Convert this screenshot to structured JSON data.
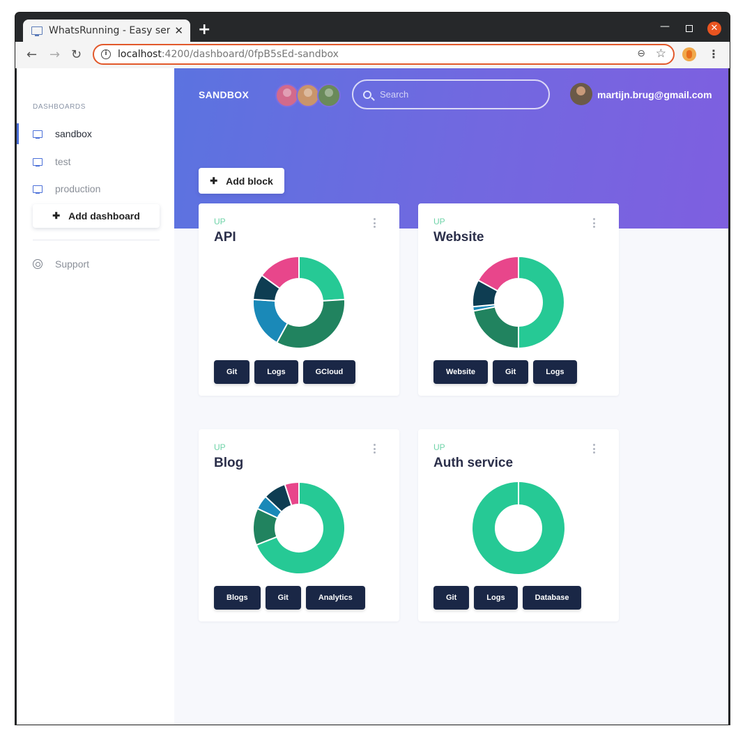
{
  "browser": {
    "tab_title": "WhatsRunning - Easy serv",
    "url_host": "localhost",
    "url_path": ":4200/dashboard/0fpB5sEd-sandbox"
  },
  "sidebar": {
    "heading": "DASHBOARDS",
    "items": [
      {
        "label": "sandbox",
        "active": true
      },
      {
        "label": "test",
        "active": false
      },
      {
        "label": "production",
        "active": false
      }
    ],
    "add_dashboard": "Add dashboard",
    "support": "Support"
  },
  "header": {
    "title": "SANDBOX",
    "search_placeholder": "Search",
    "user_email": "martijn.brug@gmail.com"
  },
  "add_block": "Add block",
  "colors": {
    "green": "#26c995",
    "dark_green": "#21835f",
    "blue": "#1a89b8",
    "navy": "#0e3d52",
    "pink": "#e8468b",
    "button_bg": "#1a2746"
  },
  "cards": [
    {
      "status": "UP",
      "title": "API",
      "segments": [
        {
          "value": 24,
          "color": "#26c995"
        },
        {
          "value": 34,
          "color": "#21835f"
        },
        {
          "value": 18,
          "color": "#1a89b8"
        },
        {
          "value": 9,
          "color": "#0e3d52"
        },
        {
          "value": 15,
          "color": "#e8468b"
        }
      ],
      "buttons": [
        "Git",
        "Logs",
        "GCloud"
      ]
    },
    {
      "status": "UP",
      "title": "Website",
      "segments": [
        {
          "value": 50,
          "color": "#26c995"
        },
        {
          "value": 22,
          "color": "#21835f"
        },
        {
          "value": 1.5,
          "color": "#1a89b8"
        },
        {
          "value": 9.5,
          "color": "#0e3d52"
        },
        {
          "value": 17,
          "color": "#e8468b"
        }
      ],
      "buttons": [
        "Website",
        "Git",
        "Logs"
      ]
    },
    {
      "status": "UP",
      "title": "Blog",
      "segments": [
        {
          "value": 69,
          "color": "#26c995"
        },
        {
          "value": 13,
          "color": "#21835f"
        },
        {
          "value": 5,
          "color": "#1a89b8"
        },
        {
          "value": 8,
          "color": "#0e3d52"
        },
        {
          "value": 5,
          "color": "#e8468b"
        }
      ],
      "buttons": [
        "Blogs",
        "Git",
        "Analytics"
      ]
    },
    {
      "status": "UP",
      "title": "Auth service",
      "segments": [
        {
          "value": 100,
          "color": "#26c995"
        }
      ],
      "buttons": [
        "Git",
        "Logs",
        "Database"
      ]
    }
  ]
}
